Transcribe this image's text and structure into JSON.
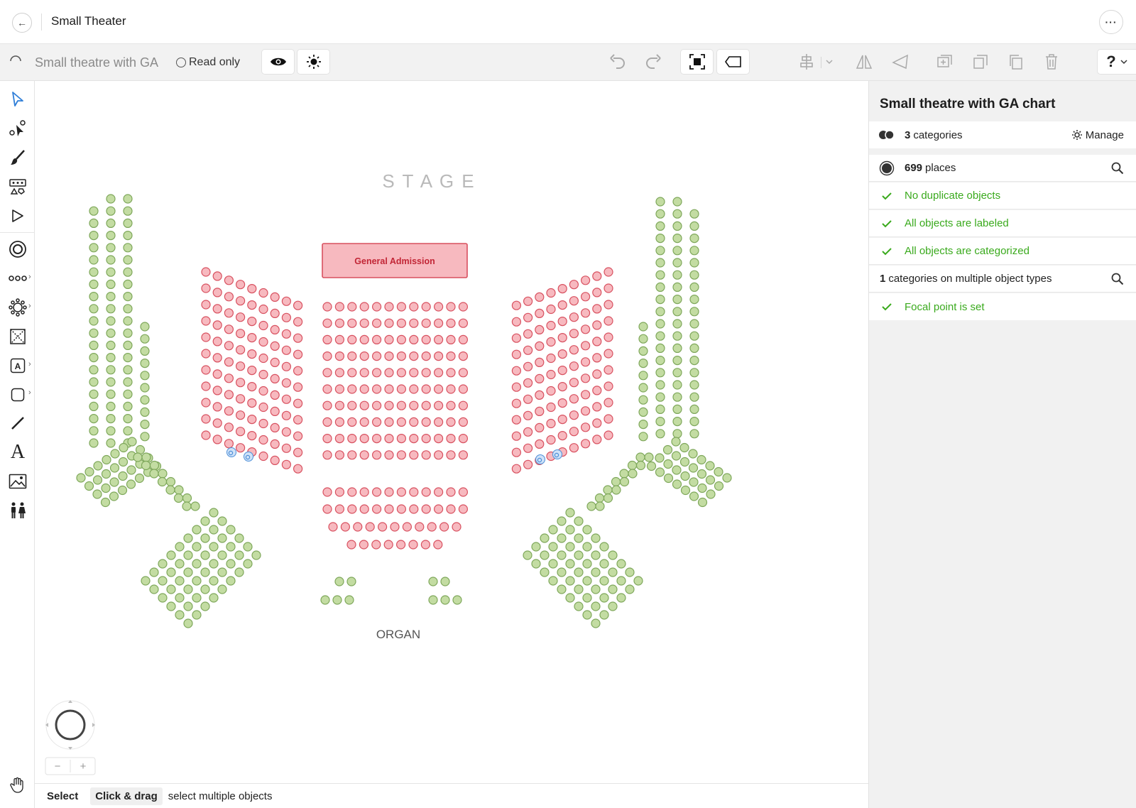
{
  "header": {
    "title": "Small Theater",
    "more_label": "···"
  },
  "toolbar": {
    "chart_name": "Small theatre with GA",
    "read_only_label": "Read only"
  },
  "canvas": {
    "stage_label": "S T A G E",
    "ga_label": "General Admission",
    "organ_label": "ORGAN",
    "colors": {
      "ga_seat_fill": "#f7b9bf",
      "ga_seat_stroke": "#d8505f",
      "section_seat_fill": "#c3dca2",
      "section_seat_stroke": "#7ea75a",
      "wheelchair": "#4d8fd8"
    },
    "zoom_minus": "−",
    "zoom_plus": "+"
  },
  "status": {
    "mode": "Select",
    "key": "Click & drag",
    "description": "select multiple objects"
  },
  "panel": {
    "title": "Small theatre with GA chart",
    "categories_count": "3",
    "categories_label": "categories",
    "manage_label": "Manage",
    "places_count": "699",
    "places_label": "places",
    "checks": [
      "No duplicate objects",
      "All objects are labeled",
      "All objects are categorized"
    ],
    "multi_count": "1",
    "multi_label": "categories on multiple object types",
    "focal_label": "Focal point is set",
    "ok_color": "#3aaa1d"
  }
}
